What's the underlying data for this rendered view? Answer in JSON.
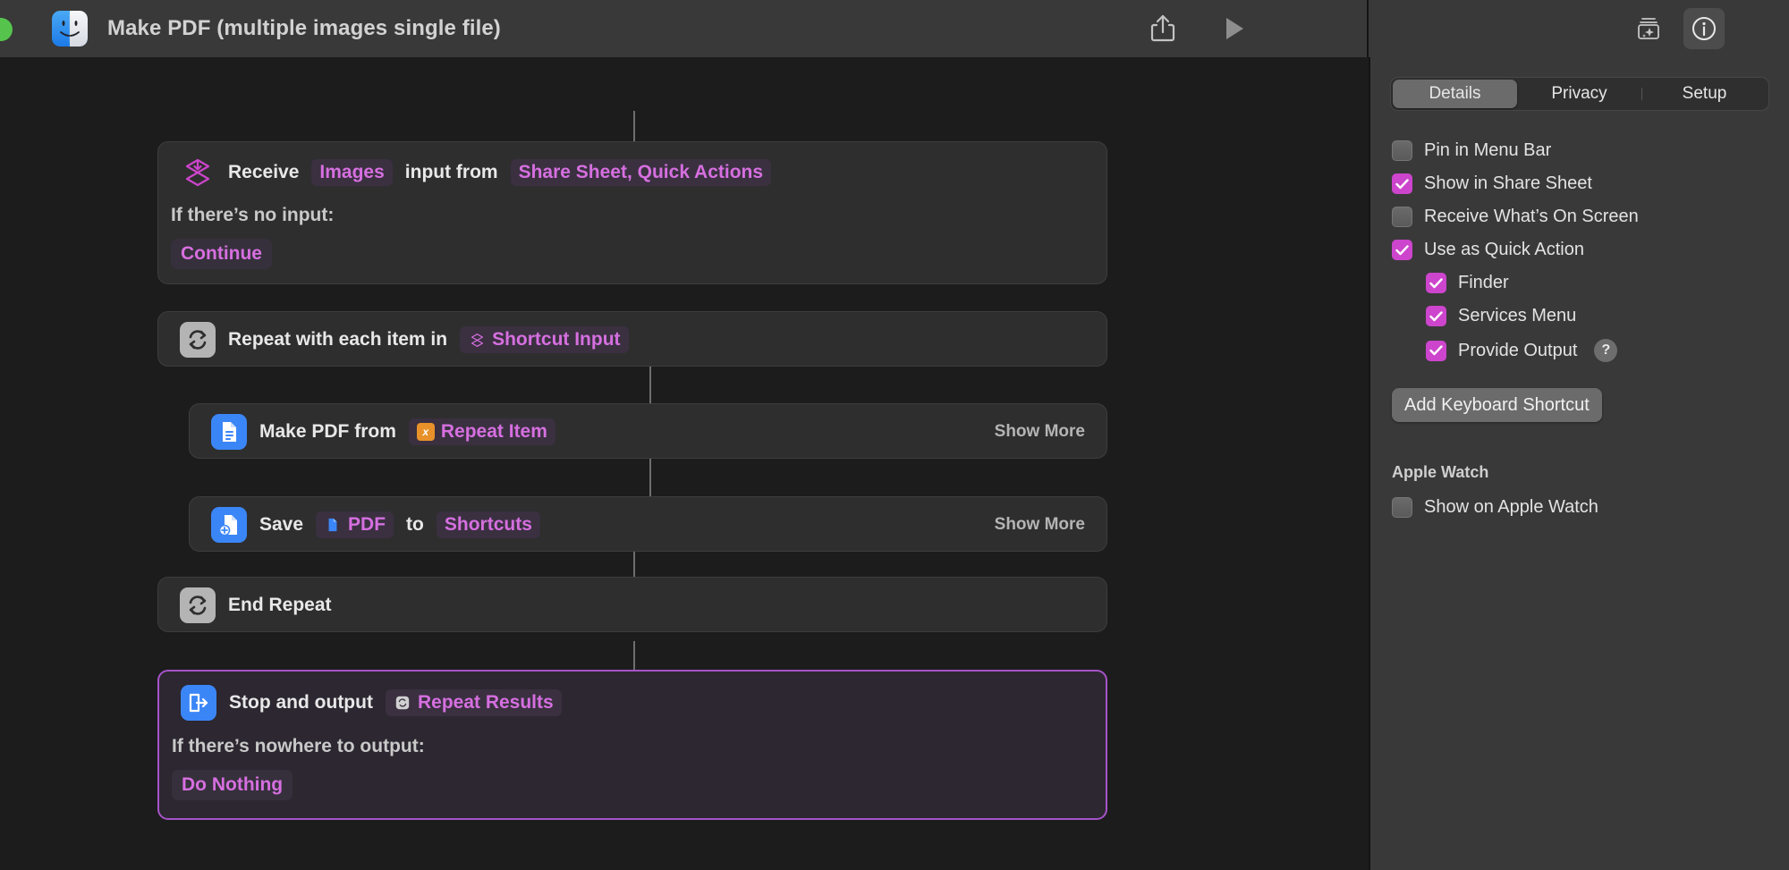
{
  "window": {
    "title": "Make PDF (multiple images single file)",
    "app_icon": "finder-icon",
    "traffic_light": "green-maximize-dot",
    "share_icon": "share-icon",
    "run_icon": "play-icon",
    "gallery_icon": "shortcut-gallery-sparkle-icon",
    "info_icon": "info-icon"
  },
  "actions": [
    {
      "id": "receive",
      "icon": "receive-input-chevron-icon",
      "parts": [
        {
          "type": "text",
          "value": "Receive"
        },
        {
          "type": "pill",
          "value": "Images"
        },
        {
          "type": "text",
          "value": "input from"
        },
        {
          "type": "pill",
          "value": "Share Sheet, Quick Actions"
        }
      ],
      "sub_label": "If there’s no input:",
      "sub_value": "Continue"
    },
    {
      "id": "repeat",
      "icon": "repeat-loop-icon",
      "parts": [
        {
          "type": "text",
          "value": "Repeat with each item in"
        },
        {
          "type": "pill-var",
          "value": "Shortcut Input",
          "badge": "shortcut-input-glyph"
        }
      ]
    },
    {
      "id": "make-pdf",
      "icon": "document-pdf-icon",
      "parts": [
        {
          "type": "text",
          "value": "Make PDF from"
        },
        {
          "type": "pill-var",
          "value": "Repeat Item",
          "badge": "variable-x-badge"
        }
      ],
      "show_more": "Show More"
    },
    {
      "id": "save",
      "icon": "save-document-icon",
      "parts": [
        {
          "type": "text",
          "value": "Save"
        },
        {
          "type": "pill-var",
          "value": "PDF",
          "badge": "pdf-file-glyph"
        },
        {
          "type": "text",
          "value": "to"
        },
        {
          "type": "pill",
          "value": "Shortcuts"
        }
      ],
      "show_more": "Show More"
    },
    {
      "id": "end-repeat",
      "icon": "repeat-loop-icon",
      "parts": [
        {
          "type": "text",
          "value": "End Repeat"
        }
      ]
    },
    {
      "id": "stop-and-output",
      "icon": "stop-and-output-icon",
      "selected": true,
      "parts": [
        {
          "type": "text",
          "value": "Stop and output"
        },
        {
          "type": "pill-var",
          "value": "Repeat Results",
          "badge": "repeat-results-glyph"
        }
      ],
      "sub_label": "If there’s nowhere to output:",
      "sub_value": "Do Nothing"
    }
  ],
  "inspector": {
    "tabs": [
      {
        "label": "Details",
        "active": true
      },
      {
        "label": "Privacy",
        "active": false
      },
      {
        "label": "Setup",
        "active": false
      }
    ],
    "options": [
      {
        "label": "Pin in Menu Bar",
        "checked": false,
        "indent": false
      },
      {
        "label": "Show in Share Sheet",
        "checked": true,
        "indent": false
      },
      {
        "label": "Receive What’s On Screen",
        "checked": false,
        "indent": false
      },
      {
        "label": "Use as Quick Action",
        "checked": true,
        "indent": false
      },
      {
        "label": "Finder",
        "checked": true,
        "indent": true
      },
      {
        "label": "Services Menu",
        "checked": true,
        "indent": true
      },
      {
        "label": "Provide Output",
        "checked": true,
        "indent": true,
        "help": "?"
      }
    ],
    "keyboard_button": "Add Keyboard Shortcut",
    "watch_section_title": "Apple Watch",
    "watch_option": {
      "label": "Show on Apple Watch",
      "checked": false
    }
  },
  "colors": {
    "accent_purple": "#cc45cc",
    "pill_text": "#d66fe0",
    "card_bg": "#2e2e2e",
    "canvas_bg": "#1c1c1c",
    "chrome_bg": "#393939",
    "icon_blue": "#3b86f7",
    "variable_orange": "#e8912a",
    "traffic_green": "#56c44c"
  }
}
